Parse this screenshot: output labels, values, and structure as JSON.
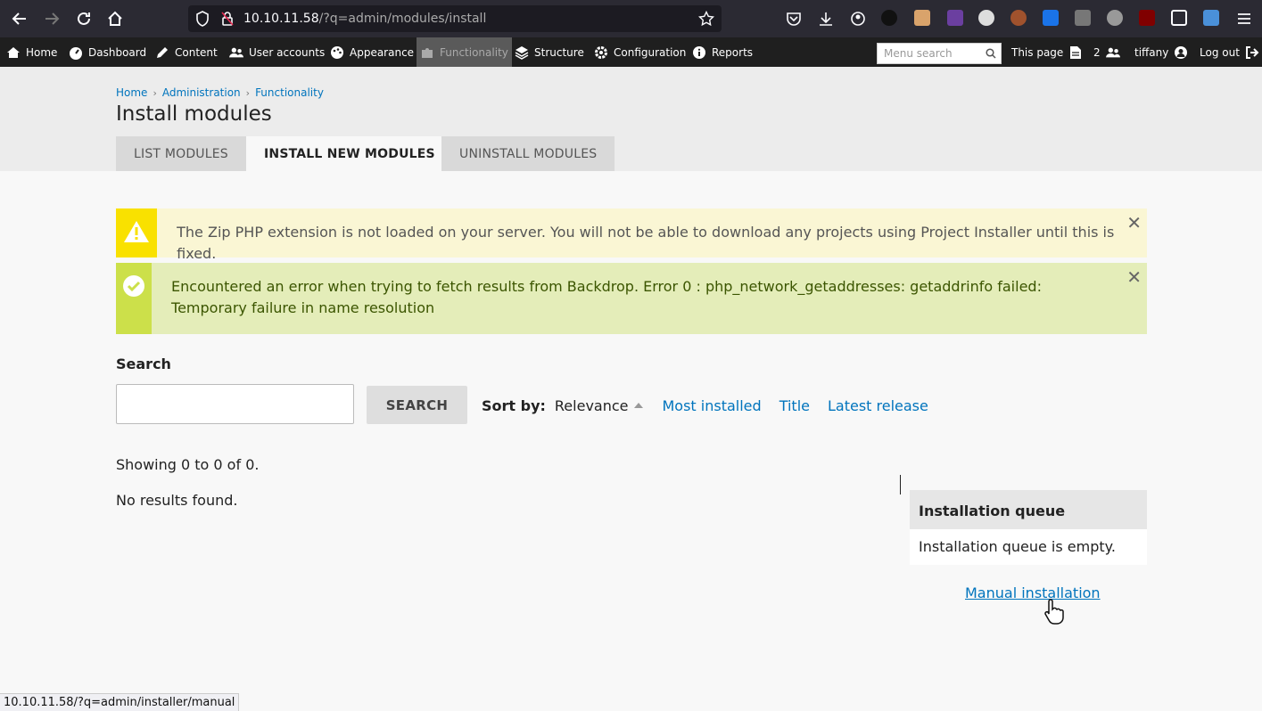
{
  "browser": {
    "url_host": "10.10.11.58",
    "url_path": "/?q=admin/modules/install",
    "status_url": "10.10.11.58/?q=admin/installer/manual"
  },
  "adminbar": {
    "items": [
      "Home",
      "Dashboard",
      "Content",
      "User accounts",
      "Appearance",
      "Functionality",
      "Structure",
      "Configuration",
      "Reports"
    ],
    "menu_search_placeholder": "Menu search",
    "this_page": "This page",
    "users_count": "2",
    "username": "tiffany",
    "logout": "Log out"
  },
  "breadcrumb": [
    "Home",
    "Administration",
    "Functionality"
  ],
  "page_title": "Install modules",
  "tabs": [
    "LIST MODULES",
    "INSTALL NEW MODULES",
    "UNINSTALL MODULES"
  ],
  "messages": {
    "warning": "The Zip PHP extension is not loaded on your server. You will not be able to download any projects using Project Installer until this is fixed.",
    "status": "Encountered an error when trying to fetch results from Backdrop. Error 0 : php_network_getaddresses: getaddrinfo failed: Temporary failure in name resolution"
  },
  "search": {
    "label": "Search",
    "button": "SEARCH",
    "value": ""
  },
  "sort": {
    "label": "Sort by:",
    "current": "Relevance",
    "options": [
      "Most installed",
      "Title",
      "Latest release"
    ]
  },
  "results": {
    "showing": "Showing 0 to 0 of 0.",
    "empty": "No results found."
  },
  "queue": {
    "title": "Installation queue",
    "empty": "Installation queue is empty.",
    "manual_link": "Manual installation"
  },
  "colors": {
    "link": "#0074bd",
    "warning_bar": "#f9e100",
    "status_bar": "#cce04a"
  }
}
